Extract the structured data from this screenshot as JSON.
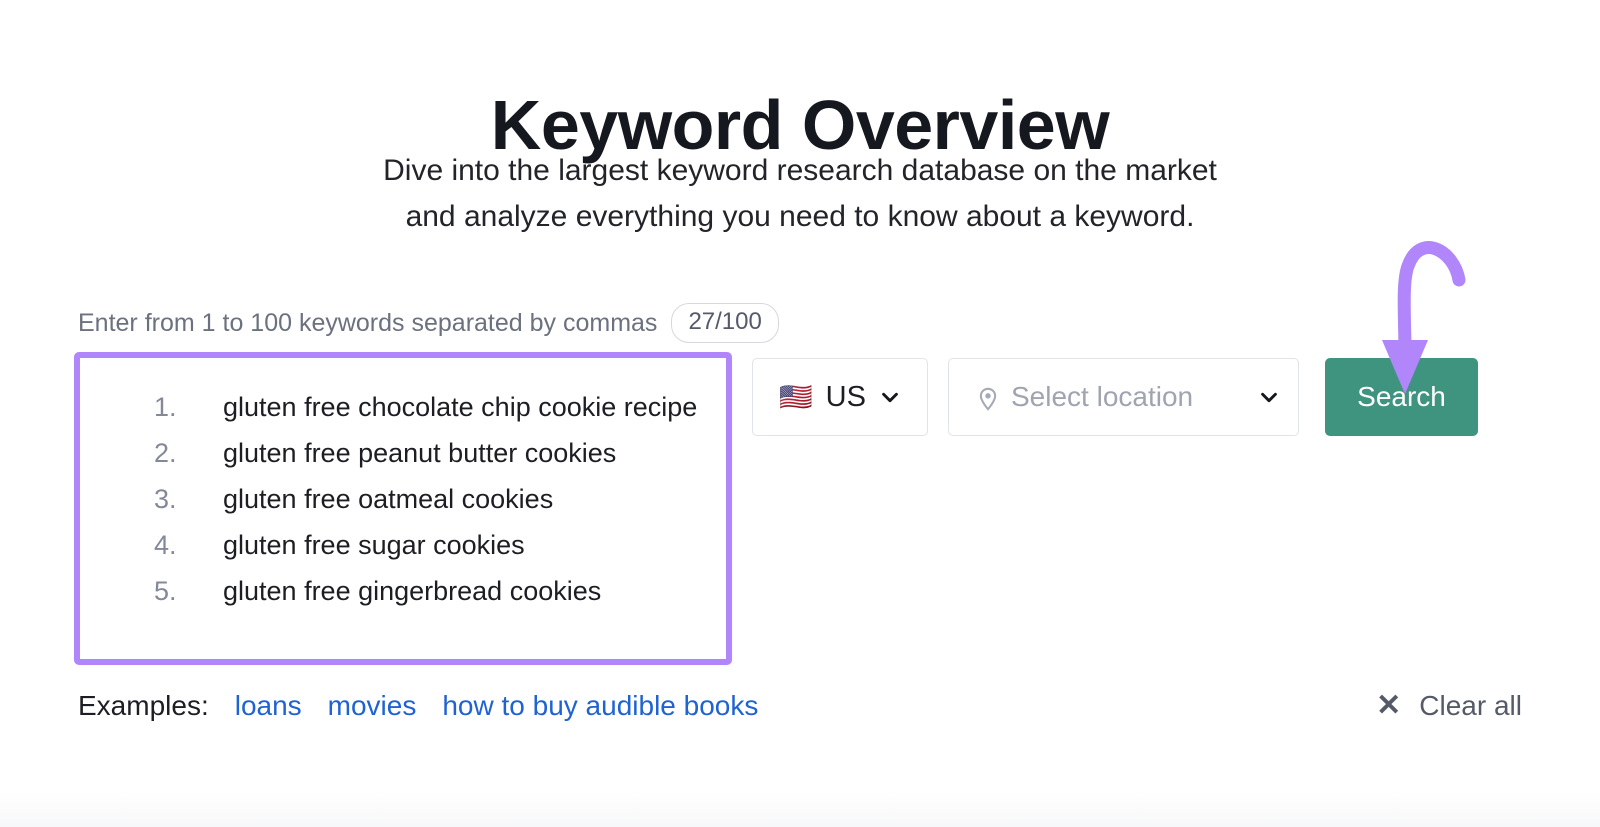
{
  "header": {
    "title": "Keyword Overview",
    "subtitle_line1": "Dive into the largest keyword research database on the market",
    "subtitle_line2": "and analyze everything you need to know about a keyword."
  },
  "keyword_field": {
    "label": "Enter from 1 to 100 keywords separated by commas",
    "counter": "27/100",
    "counter_current": 27,
    "counter_max": 100,
    "keywords": [
      "gluten free chocolate chip cookie recipe",
      "gluten free peanut butter cookies",
      "gluten free oatmeal cookies",
      "gluten free sugar cookies",
      "gluten free gingerbread cookies"
    ],
    "highlight_color": "#b086fa"
  },
  "country_select": {
    "flag": "🇺🇸",
    "flag_icon_name": "us-flag-icon",
    "code": "US",
    "chevron_icon": "chevron-down-icon"
  },
  "location_select": {
    "pin_icon": "map-pin-icon",
    "placeholder": "Select location",
    "value": "",
    "chevron_icon": "chevron-down-icon"
  },
  "search_button": {
    "label": "Search",
    "color": "#3f9480",
    "text_color": "#ffffff"
  },
  "annotation": {
    "arrow_icon": "curved-down-arrow-icon",
    "color": "#b086fa",
    "points_to": "Search"
  },
  "examples": {
    "label": "Examples:",
    "links": [
      "loans",
      "movies",
      "how to buy audible books"
    ],
    "link_color": "#1f62d4"
  },
  "clear_all": {
    "icon": "close-x-icon",
    "label": "Clear all"
  }
}
